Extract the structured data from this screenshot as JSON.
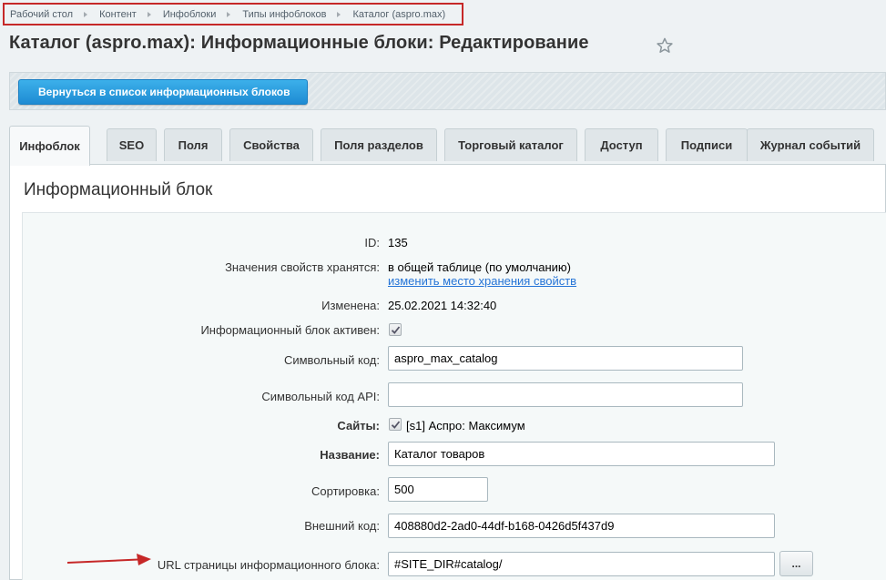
{
  "breadcrumbs": [
    "Рабочий стол",
    "Контент",
    "Инфоблоки",
    "Типы инфоблоков",
    "Каталог (aspro.max)"
  ],
  "page_title": "Каталог (aspro.max): Информационные блоки: Редактирование",
  "toolbar": {
    "back_label": "Вернуться в список информационных блоков"
  },
  "tabs": [
    {
      "label": "Инфоблок",
      "active": true
    },
    {
      "label": "SEO"
    },
    {
      "label": "Поля"
    },
    {
      "label": "Свойства"
    },
    {
      "label": "Поля разделов"
    },
    {
      "label": "Торговый каталог"
    },
    {
      "label": "Доступ"
    },
    {
      "label": "Подписи"
    },
    {
      "label": "Журнал событий"
    }
  ],
  "section_title": "Информационный блок",
  "form": {
    "id": {
      "label": "ID:",
      "value": "135"
    },
    "storage": {
      "label": "Значения свойств хранятся:",
      "value": "в общей таблице (по умолчанию)",
      "link": "изменить место хранения свойств"
    },
    "modified": {
      "label": "Изменена:",
      "value": "25.02.2021 14:32:40"
    },
    "active": {
      "label": "Информационный блок активен:",
      "checked": true
    },
    "code": {
      "label": "Символьный код:",
      "value": "aspro_max_catalog"
    },
    "api_code": {
      "label": "Символьный код API:",
      "value": ""
    },
    "sites": {
      "label": "Сайты:",
      "value": "[s1] Аспро: Максимум",
      "checked": true
    },
    "name": {
      "label": "Название:",
      "value": "Каталог товаров"
    },
    "sort": {
      "label": "Сортировка:",
      "value": "500"
    },
    "external_code": {
      "label": "Внешний код:",
      "value": "408880d2-2ad0-44df-b168-0426d5f437d9"
    },
    "url": {
      "label": "URL страницы информационного блока:",
      "value": "#SITE_DIR#catalog/",
      "button": "..."
    }
  },
  "colors": {
    "accent": "#1e8bd3",
    "highlight": "#c62828",
    "link": "#2675d7"
  }
}
